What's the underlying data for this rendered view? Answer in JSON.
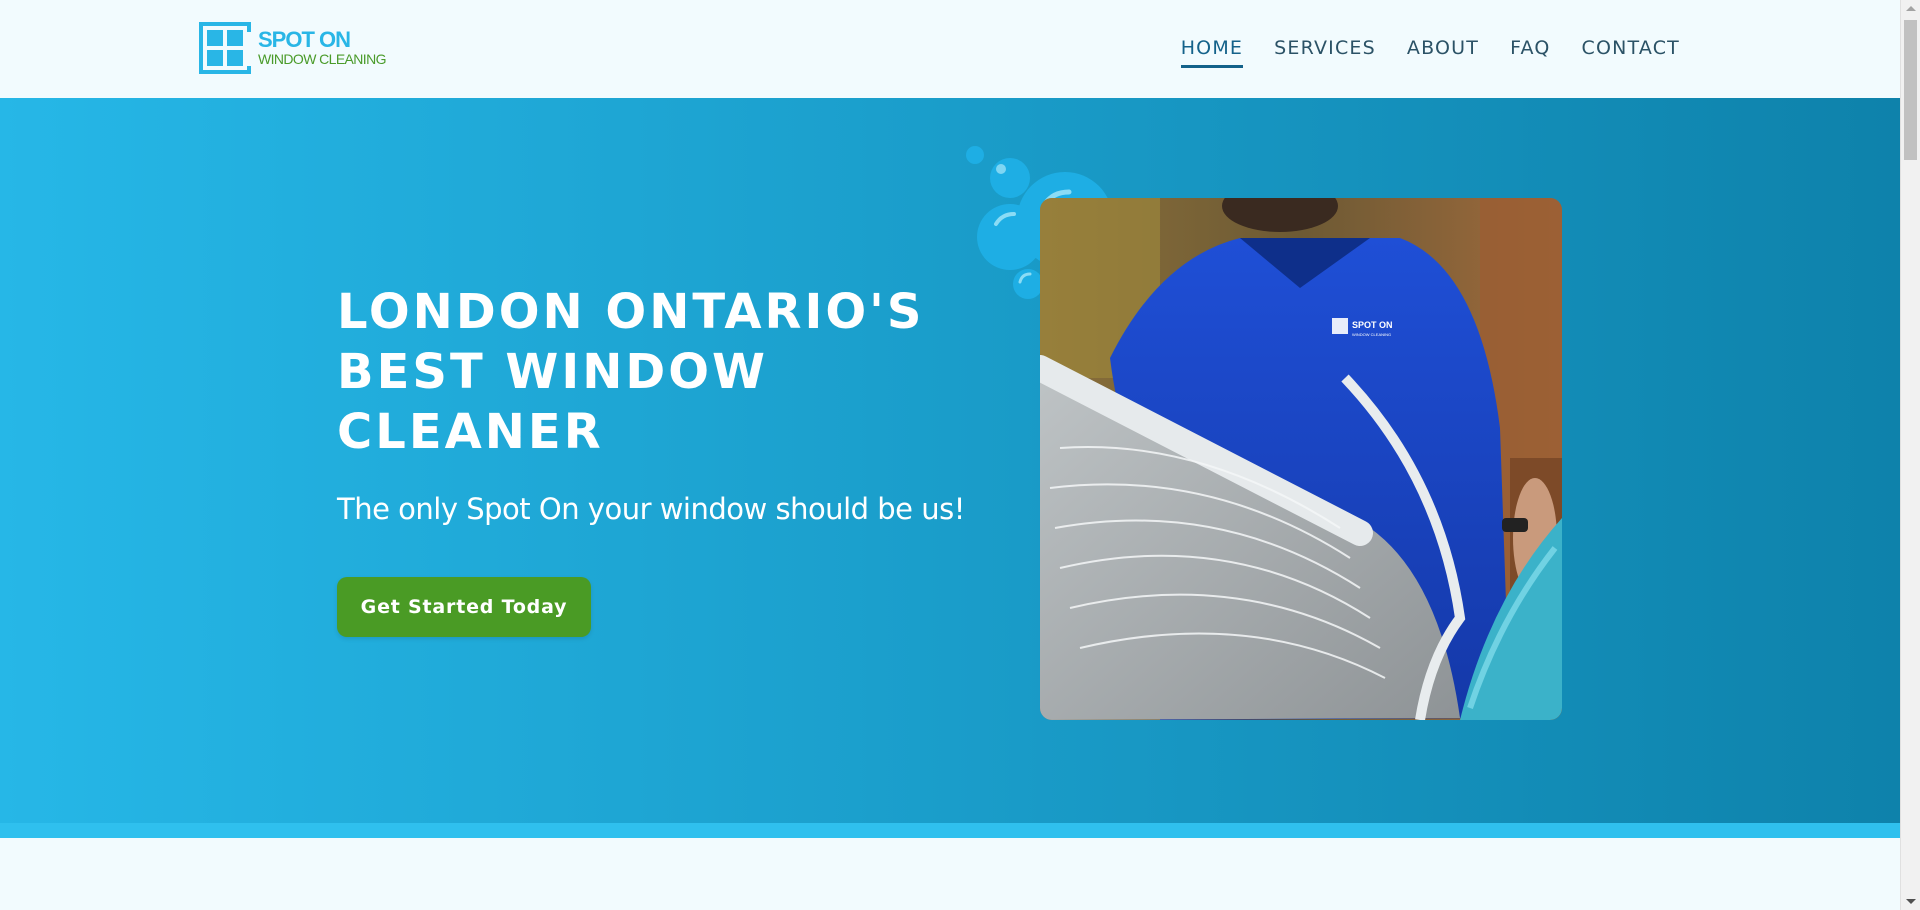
{
  "header": {
    "logo": {
      "title": "SPOT ON",
      "subtitle": "WINDOW CLEANING",
      "icon": "window-logo-icon",
      "color_primary": "#29b6e6",
      "color_secondary": "#4a9b2a"
    },
    "nav": [
      {
        "label": "HOME",
        "active": true
      },
      {
        "label": "SERVICES",
        "active": false
      },
      {
        "label": "ABOUT",
        "active": false
      },
      {
        "label": "FAQ",
        "active": false
      },
      {
        "label": "CONTACT",
        "active": false
      }
    ]
  },
  "hero": {
    "title": "LONDON ONTARIO'S BEST WINDOW CLEANER",
    "subtitle": "The only Spot On your window should be us!",
    "cta_label": "Get Started Today",
    "photo_icon": "window-cleaner-photo",
    "shirt_logo_title": "SPOT ON",
    "shirt_logo_subtitle": "WINDOW CLEANING",
    "colors": {
      "gradient_start": "#26b7e7",
      "gradient_end": "#0e82ab",
      "cta": "#4a9b25",
      "bubbles": "#1eaee4"
    }
  }
}
